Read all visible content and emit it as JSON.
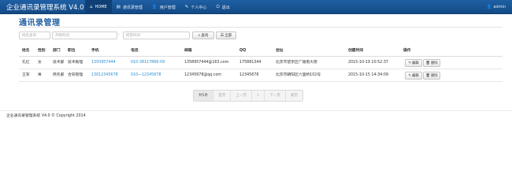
{
  "navbar": {
    "brand": "企业通讯录管理系统 V4.0",
    "items": [
      {
        "icon": "home-icon",
        "glyph": "⌂",
        "label": "HOME",
        "active": true
      },
      {
        "icon": "address-book-icon",
        "glyph": "▤",
        "label": "通讯录管理",
        "active": true
      },
      {
        "icon": "user-icon",
        "glyph": "👤",
        "label": "用户管理",
        "active": false
      },
      {
        "icon": "wrench-icon",
        "glyph": "✎",
        "label": "个人中心",
        "active": false
      },
      {
        "icon": "logout-icon",
        "glyph": "⏻",
        "label": "退出",
        "active": false
      }
    ],
    "right": {
      "icon": "user-icon",
      "glyph": "👤",
      "label": "admin"
    }
  },
  "page": {
    "title": "通讯录管理"
  },
  "search": {
    "name_placeholder": "姓名查询",
    "start_placeholder": "开始时间",
    "separator": "-",
    "end_placeholder": "结束时间",
    "search_label": "查询",
    "all_label": "全部"
  },
  "table": {
    "headers": [
      "姓名",
      "性别",
      "部门",
      "职位",
      "手机",
      "电话",
      "邮箱",
      "QQ",
      "住址",
      "创建时间",
      "操作"
    ],
    "rows": [
      [
        "孔红",
        "女",
        "技术部",
        "技术助理",
        "1350957444",
        "010-38117866-09",
        "1358957444@163.com",
        "175881344",
        "北京市望京区广顺南大街",
        "2015-10-19 10:52:37"
      ],
      [
        "王军",
        "男",
        "商务部",
        "合同管理",
        "13012345678",
        "010—12345678",
        "12345678@qq.com",
        "12345678",
        "北京市朝阳区六里桥102号",
        "2015-10-15 14:34:09"
      ]
    ],
    "edit_label": "编辑",
    "delete_label": "删除"
  },
  "pager": {
    "info": "共5条",
    "first": "首页",
    "prev": "上一页",
    "current": "1",
    "next": "下一页",
    "last": "尾页"
  },
  "footer": {
    "text": "企业通讯录管理系统 V4.0 © Copyright 2014"
  }
}
